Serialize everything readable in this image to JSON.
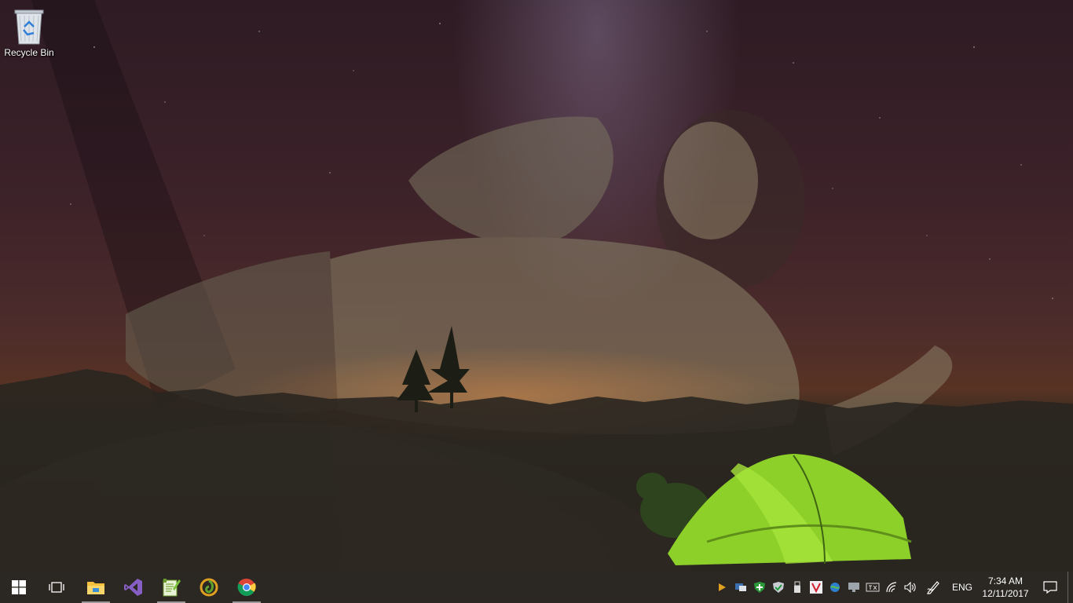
{
  "desktop": {
    "icons": [
      {
        "label": "Recycle Bin",
        "icon": "recycle-bin-icon"
      }
    ]
  },
  "taskbar": {
    "start": {
      "icon": "windows-start-icon"
    },
    "task_view": {
      "icon": "task-view-icon"
    },
    "pinned": [
      {
        "icon": "file-explorer-icon",
        "running": true
      },
      {
        "icon": "visual-studio-icon",
        "running": false
      },
      {
        "icon": "notepad-plus-plus-icon",
        "running": true
      },
      {
        "icon": "lazarus-ide-icon",
        "running": false
      },
      {
        "icon": "chrome-icon",
        "running": true
      }
    ],
    "tray": {
      "icons": [
        "media-play-icon",
        "network-monitor-icon",
        "security-shield-icon",
        "defender-icon",
        "usb-drive-icon",
        "vivaldi-icon",
        "globe-sync-icon",
        "display-icon",
        "input-method-icon",
        "wifi-icon",
        "volume-icon",
        "pen-icon"
      ],
      "language": "ENG",
      "time": "7:34 AM",
      "date": "12/11/2017"
    }
  },
  "colors": {
    "taskbar_bg": "#2c2822",
    "accent_orange": "#e06e23",
    "tent_green": "#8ed02a"
  }
}
